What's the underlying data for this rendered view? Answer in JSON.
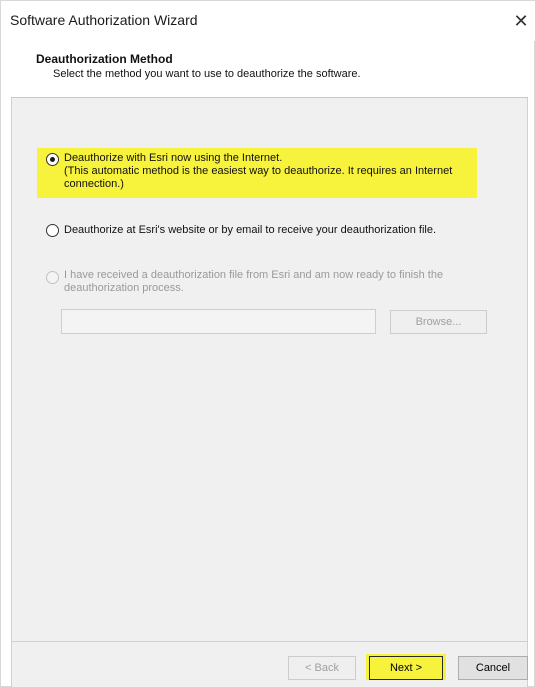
{
  "window": {
    "title": "Software Authorization Wizard",
    "close_glyph": "✕"
  },
  "header": {
    "title": "Deauthorization Method",
    "subtitle": "Select the method you want to use to deauthorize the software."
  },
  "options": [
    {
      "line1": "Deauthorize with Esri now using the Internet.",
      "line2": "(This automatic method is the easiest way to deauthorize. It requires an Internet",
      "line3": "connection.)",
      "selected": true,
      "enabled": true
    },
    {
      "line1": "Deauthorize at Esri's website or by email to receive your deauthorization file.",
      "selected": false,
      "enabled": true
    },
    {
      "line1": "I have received a deauthorization file from Esri and am now ready to finish the",
      "line2": "deauthorization process.",
      "selected": false,
      "enabled": false
    }
  ],
  "file_input": {
    "value": ""
  },
  "browse_label": "Browse...",
  "footer": {
    "back_label": "< Back",
    "next_label": "Next >",
    "cancel_label": "Cancel"
  },
  "colors": {
    "highlight": "#f7f23c",
    "panel_bg": "#f0f0f0"
  }
}
